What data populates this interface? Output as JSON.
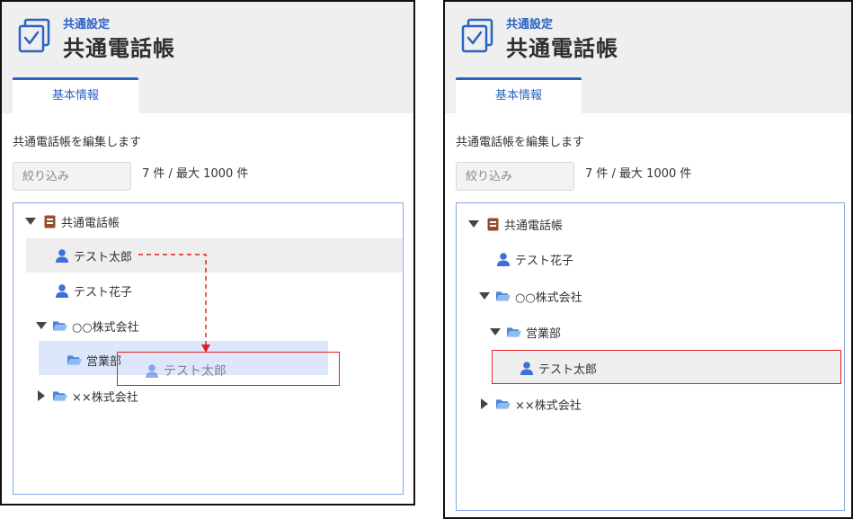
{
  "app": {
    "subtitle": "共通設定",
    "title": "共通電話帳",
    "tab_label": "基本情報",
    "description": "共通電話帳を編集します",
    "filter_placeholder": "絞り込み",
    "count_text": "7 件 / 最大 1000 件"
  },
  "colors": {
    "accent": "#2b63c4",
    "person_icon": "#3e6fd8",
    "folder_icon": "#6aa0e8",
    "book_icon": "#9b4a2c",
    "highlight": "#e02020"
  },
  "icons": {
    "app": "checkbox-icon",
    "root": "phonebook-icon",
    "contact": "person-icon",
    "group": "folder-icon",
    "expanded": "triangle-down-icon",
    "collapsed": "triangle-right-icon"
  },
  "before": {
    "tree": {
      "root_label": "共通電話帳",
      "contact_taro": "テスト太郎",
      "contact_hanako": "テスト花子",
      "company_oo": "○○株式会社",
      "dept_eigyo": "営業部",
      "dragged_contact": "テスト太郎",
      "company_xx": "××株式会社"
    }
  },
  "after": {
    "tree": {
      "root_label": "共通電話帳",
      "contact_hanako": "テスト花子",
      "company_oo": "○○株式会社",
      "dept_eigyo": "営業部",
      "contact_taro": "テスト太郎",
      "company_xx": "××株式会社"
    }
  }
}
